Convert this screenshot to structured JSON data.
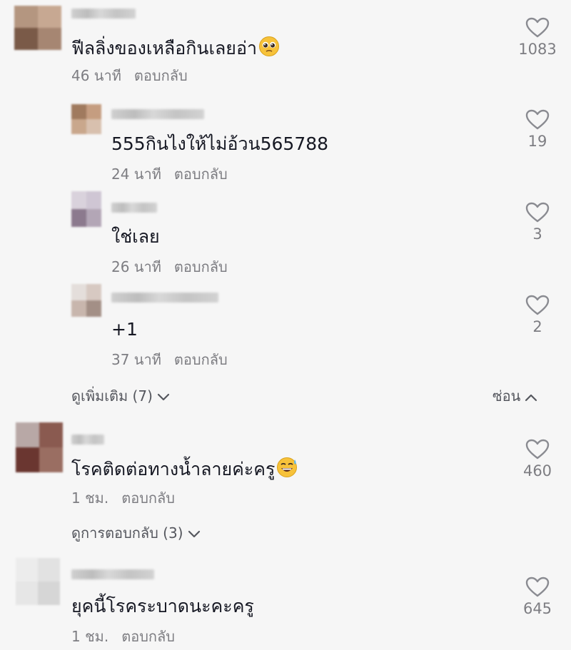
{
  "comments": [
    {
      "text": "ฟีลลิ่งของเหลือกินเลยอ่า",
      "emoji": "pleading-face",
      "time": "46 นาที",
      "reply_label": "ตอบกลับ",
      "likes": "1083"
    },
    {
      "text": "555กินไงให้ไม่อ้วน565788",
      "time": "24 นาที",
      "reply_label": "ตอบกลับ",
      "likes": "19"
    },
    {
      "text": "ใช่เลย",
      "time": "26 นาที",
      "reply_label": "ตอบกลับ",
      "likes": "3"
    },
    {
      "text": "+1",
      "time": "37 นาที",
      "reply_label": "ตอบกลับ",
      "likes": "2"
    },
    {
      "text": "โรคติดต่อทางน้ำลายค่ะครู",
      "emoji": "grinning-sweat-face",
      "time": "1 ชม.",
      "reply_label": "ตอบกลับ",
      "likes": "460"
    },
    {
      "text": "ยุคนี้โรคระบาดนะคะครู",
      "time": "1 ชม.",
      "reply_label": "ตอบกลับ",
      "likes": "645"
    }
  ],
  "thread1": {
    "view_more": "ดูเพิ่มเติม (7)",
    "hide": "ซ่อน"
  },
  "thread2": {
    "view_replies": "ดูการตอบกลับ (3)"
  },
  "colors": {
    "background": "#f6f6f6",
    "text": "#161823",
    "muted": "#7d7d82",
    "heart_stroke": "#8a8b91",
    "emoji_yellow": "#f7c23a"
  }
}
